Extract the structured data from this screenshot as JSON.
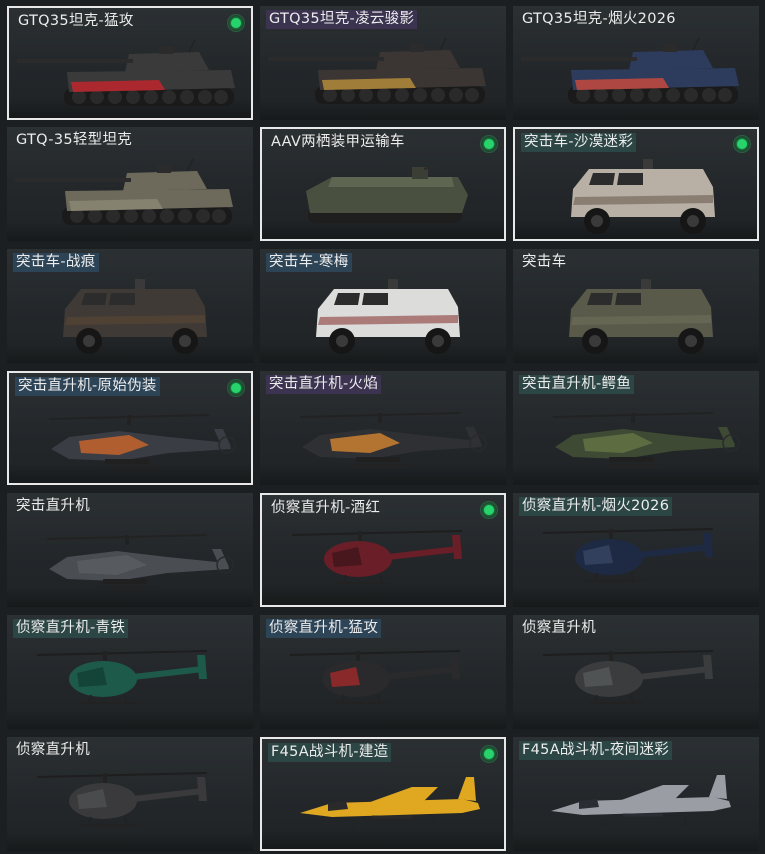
{
  "vehicles": [
    {
      "name": "GTQ35坦克-猛攻",
      "kind": "tank",
      "selected": true,
      "equipped": true,
      "tag": "none",
      "body": "#3a3a3a",
      "accent": "#c0272d"
    },
    {
      "name": "GTQ35坦克-凌云骏影",
      "kind": "tank",
      "selected": false,
      "equipped": false,
      "tag": "purple",
      "body": "#3b3633",
      "accent": "#b48a3c"
    },
    {
      "name": "GTQ35坦克-烟火2026",
      "kind": "tank",
      "selected": false,
      "equipped": false,
      "tag": "none",
      "body": "#2d3b5c",
      "accent": "#c54a3c"
    },
    {
      "name": "GTQ-35轻型坦克",
      "kind": "tank",
      "selected": false,
      "equipped": false,
      "tag": "none",
      "body": "#6d6a5c",
      "accent": "#8a8672"
    },
    {
      "name": "AAV两栖装甲运输车",
      "kind": "aav",
      "selected": true,
      "equipped": true,
      "tag": "none",
      "body": "#4a5040",
      "accent": "#5e6652"
    },
    {
      "name": "突击车-沙漠迷彩",
      "kind": "mrap",
      "selected": true,
      "equipped": true,
      "tag": "teal",
      "body": "#b8b0a4",
      "accent": "#6b5e52"
    },
    {
      "name": "突击车-战痕",
      "kind": "mrap",
      "selected": false,
      "equipped": false,
      "tag": "blue",
      "body": "#3f3a35",
      "accent": "#5b4636"
    },
    {
      "name": "突击车-寒梅",
      "kind": "mrap",
      "selected": false,
      "equipped": false,
      "tag": "blue",
      "body": "#dcdcda",
      "accent": "#8a3a3a"
    },
    {
      "name": "突击车",
      "kind": "mrap",
      "selected": false,
      "equipped": false,
      "tag": "none",
      "body": "#5a5a4a",
      "accent": "#6e6e5c"
    },
    {
      "name": "突击直升机-原始伪装",
      "kind": "attackheli",
      "selected": true,
      "equipped": true,
      "tag": "blue",
      "body": "#3a3e44",
      "accent": "#d86a2a"
    },
    {
      "name": "突击直升机-火焰",
      "kind": "attackheli",
      "selected": false,
      "equipped": false,
      "tag": "purple",
      "body": "#2e3034",
      "accent": "#e08a30"
    },
    {
      "name": "突击直升机-鳄鱼",
      "kind": "attackheli",
      "selected": false,
      "equipped": false,
      "tag": "teal",
      "body": "#3e4a34",
      "accent": "#6a7a46"
    },
    {
      "name": "突击直升机",
      "kind": "attackheli",
      "selected": false,
      "equipped": false,
      "tag": "none",
      "body": "#4a4e52",
      "accent": "#5c6064"
    },
    {
      "name": "侦察直升机-酒红",
      "kind": "scoutheli",
      "selected": true,
      "equipped": true,
      "tag": "none",
      "body": "#6a1e28",
      "accent": "#3a1218"
    },
    {
      "name": "侦察直升机-烟火2026",
      "kind": "scoutheli",
      "selected": false,
      "equipped": false,
      "tag": "teal",
      "body": "#1e2a44",
      "accent": "#3a4a6a"
    },
    {
      "name": "侦察直升机-青铁",
      "kind": "scoutheli",
      "selected": false,
      "equipped": false,
      "tag": "teal",
      "body": "#1e5a4a",
      "accent": "#103a30"
    },
    {
      "name": "侦察直升机-猛攻",
      "kind": "scoutheli",
      "selected": false,
      "equipped": false,
      "tag": "blue",
      "body": "#2a2a2c",
      "accent": "#b42a2a"
    },
    {
      "name": "侦察直升机",
      "kind": "scoutheli",
      "selected": false,
      "equipped": false,
      "tag": "none",
      "body": "#3a3c3e",
      "accent": "#5a5c5e"
    },
    {
      "name": "侦察直升机",
      "kind": "scoutheli",
      "selected": false,
      "equipped": false,
      "tag": "none",
      "body": "#3a3a3c",
      "accent": "#505254"
    },
    {
      "name": "F45A战斗机-建造",
      "kind": "jet",
      "selected": true,
      "equipped": true,
      "tag": "teal",
      "body": "#e0a820",
      "accent": "#2a2a2a"
    },
    {
      "name": "F45A战斗机-夜间迷彩",
      "kind": "jet",
      "selected": false,
      "equipped": false,
      "tag": "teal",
      "body": "#9a9ea4",
      "accent": "#2a2e34"
    }
  ]
}
